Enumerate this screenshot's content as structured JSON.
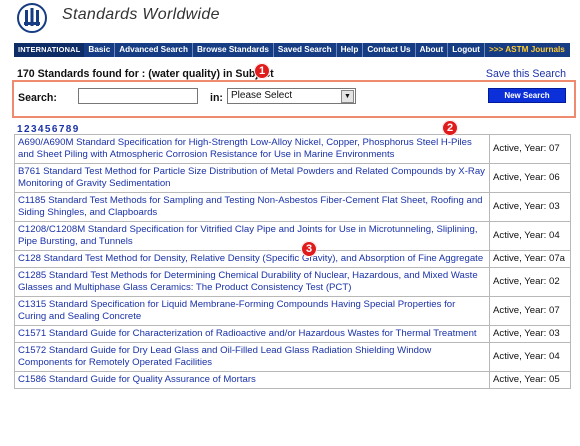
{
  "header": {
    "site_title": "Standards Worldwide"
  },
  "nav": {
    "brand": "INTERNATIONAL",
    "items": [
      "Basic",
      "Advanced Search",
      "Browse Standards",
      "Saved Search",
      "Help",
      "Contact Us",
      "About",
      "Logout",
      ">>> ASTM Journals"
    ]
  },
  "results_summary": "170 Standards found for : (water quality) in Subject",
  "save_search_label": "Save this Search",
  "search": {
    "label": "Search:",
    "value": "",
    "in_label": "in:",
    "select_value": "Please Select",
    "button_label": "New Search"
  },
  "pages": [
    "1",
    "2",
    "3",
    "4",
    "5",
    "6",
    "7",
    "8",
    "9"
  ],
  "callouts": [
    "1",
    "2",
    "3"
  ],
  "results": [
    {
      "title": "A690/A690M Standard Specification for High-Strength Low-Alloy Nickel, Copper, Phosphorus Steel H-Piles and Sheet Piling with Atmospheric Corrosion Resistance for Use in Marine Environments",
      "status": "Active, Year: 07"
    },
    {
      "title": "B761 Standard Test Method for Particle Size Distribution of Metal Powders and Related Compounds by X-Ray Monitoring of Gravity Sedimentation",
      "status": "Active, Year: 06"
    },
    {
      "title": "C1185 Standard Test Methods for Sampling and Testing Non-Asbestos Fiber-Cement Flat Sheet, Roofing and Siding Shingles, and Clapboards",
      "status": "Active, Year: 03"
    },
    {
      "title": "C1208/C1208M Standard Specification for Vitrified Clay Pipe and Joints for Use in Microtunneling, Sliplining, Pipe Bursting, and Tunnels",
      "status": "Active, Year: 04"
    },
    {
      "title": "C128 Standard Test Method for Density, Relative Density (Specific Gravity), and Absorption of Fine Aggregate",
      "status": "Active, Year: 07a"
    },
    {
      "title": "C1285 Standard Test Methods for Determining Chemical Durability of Nuclear, Hazardous, and Mixed Waste Glasses and Multiphase Glass Ceramics: The Product Consistency Test (PCT)",
      "status": "Active, Year: 02"
    },
    {
      "title": "C1315 Standard Specification for Liquid Membrane-Forming Compounds Having Special Properties for Curing and Sealing Concrete",
      "status": "Active, Year: 07"
    },
    {
      "title": "C1571 Standard Guide for Characterization of Radioactive and/or Hazardous Wastes for Thermal Treatment",
      "status": "Active, Year: 03"
    },
    {
      "title": "C1572 Standard Guide for Dry Lead Glass and Oil-Filled Lead Glass Radiation Shielding Window Components for Remotely Operated Facilities",
      "status": "Active, Year: 04"
    },
    {
      "title": "C1586 Standard Guide for Quality Assurance of Mortars",
      "status": "Active, Year: 05"
    }
  ],
  "colors": {
    "nav_bg": "#163c84",
    "link": "#1a32a8",
    "callout": "#e01b1b",
    "highlight_border": "#f08a6e",
    "button": "#0b2fd8"
  }
}
